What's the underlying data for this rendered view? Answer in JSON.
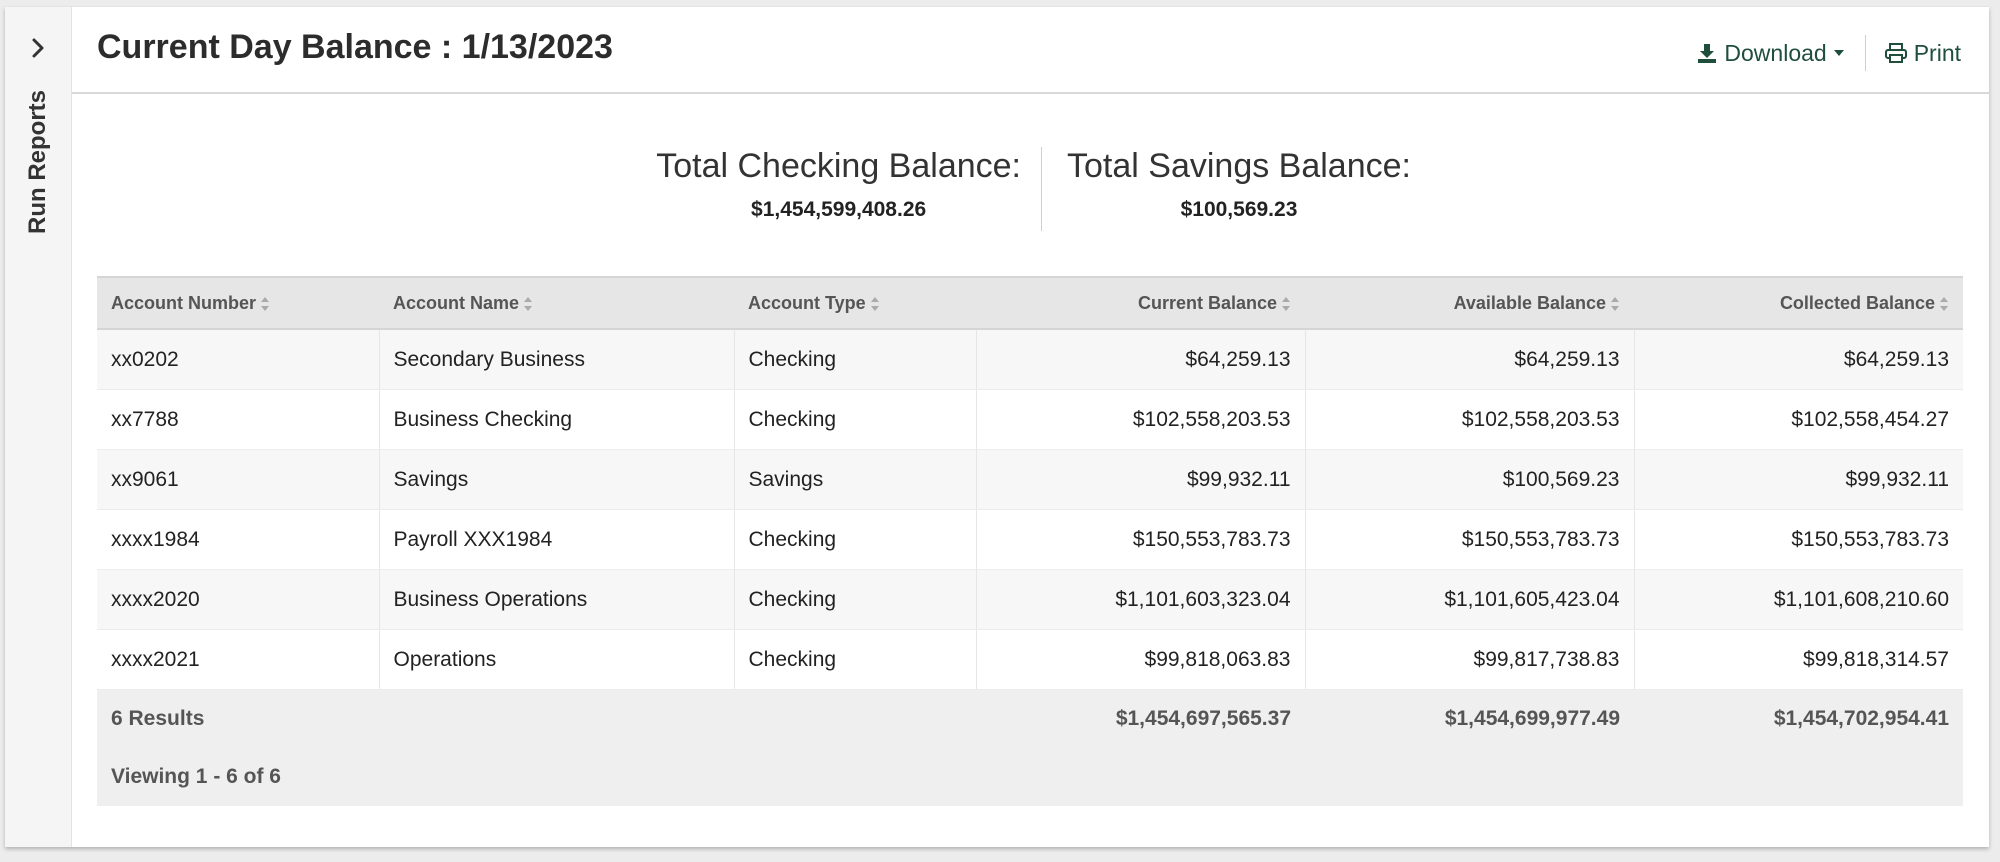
{
  "sidebar": {
    "label": "Run Reports"
  },
  "header": {
    "title": "Current Day Balance : 1/13/2023",
    "download_label": "Download",
    "print_label": "Print"
  },
  "totals": {
    "checking_label": "Total Checking Balance:",
    "checking_value": "$1,454,599,408.26",
    "savings_label": "Total Savings Balance:",
    "savings_value": "$100,569.23"
  },
  "table": {
    "columns": [
      "Account Number",
      "Account Name",
      "Account Type",
      "Current Balance",
      "Available Balance",
      "Collected Balance"
    ],
    "rows": [
      [
        "xx0202",
        "Secondary Business",
        "Checking",
        "$64,259.13",
        "$64,259.13",
        "$64,259.13"
      ],
      [
        "xx7788",
        "Business Checking",
        "Checking",
        "$102,558,203.53",
        "$102,558,203.53",
        "$102,558,454.27"
      ],
      [
        "xx9061",
        "Savings",
        "Savings",
        "$99,932.11",
        "$100,569.23",
        "$99,932.11"
      ],
      [
        "xxxx1984",
        "Payroll XXX1984",
        "Checking",
        "$150,553,783.73",
        "$150,553,783.73",
        "$150,553,783.73"
      ],
      [
        "xxxx2020",
        "Business Operations",
        "Checking",
        "$1,101,603,323.04",
        "$1,101,605,423.04",
        "$1,101,608,210.60"
      ],
      [
        "xxxx2021",
        "Operations",
        "Checking",
        "$99,818,063.83",
        "$99,817,738.83",
        "$99,818,314.57"
      ]
    ],
    "footer": {
      "results": "6 Results",
      "current_total": "$1,454,697,565.37",
      "available_total": "$1,454,699,977.49",
      "collected_total": "$1,454,702,954.41",
      "viewing": "Viewing 1 - 6 of 6"
    }
  },
  "colors": {
    "accent": "#1f4e3d",
    "header_bg": "#e6e6e6",
    "footer_bg": "#efefef"
  },
  "icons": [
    "chevron-right-icon",
    "download-icon",
    "caret-down-icon",
    "print-icon",
    "sort-icon"
  ]
}
